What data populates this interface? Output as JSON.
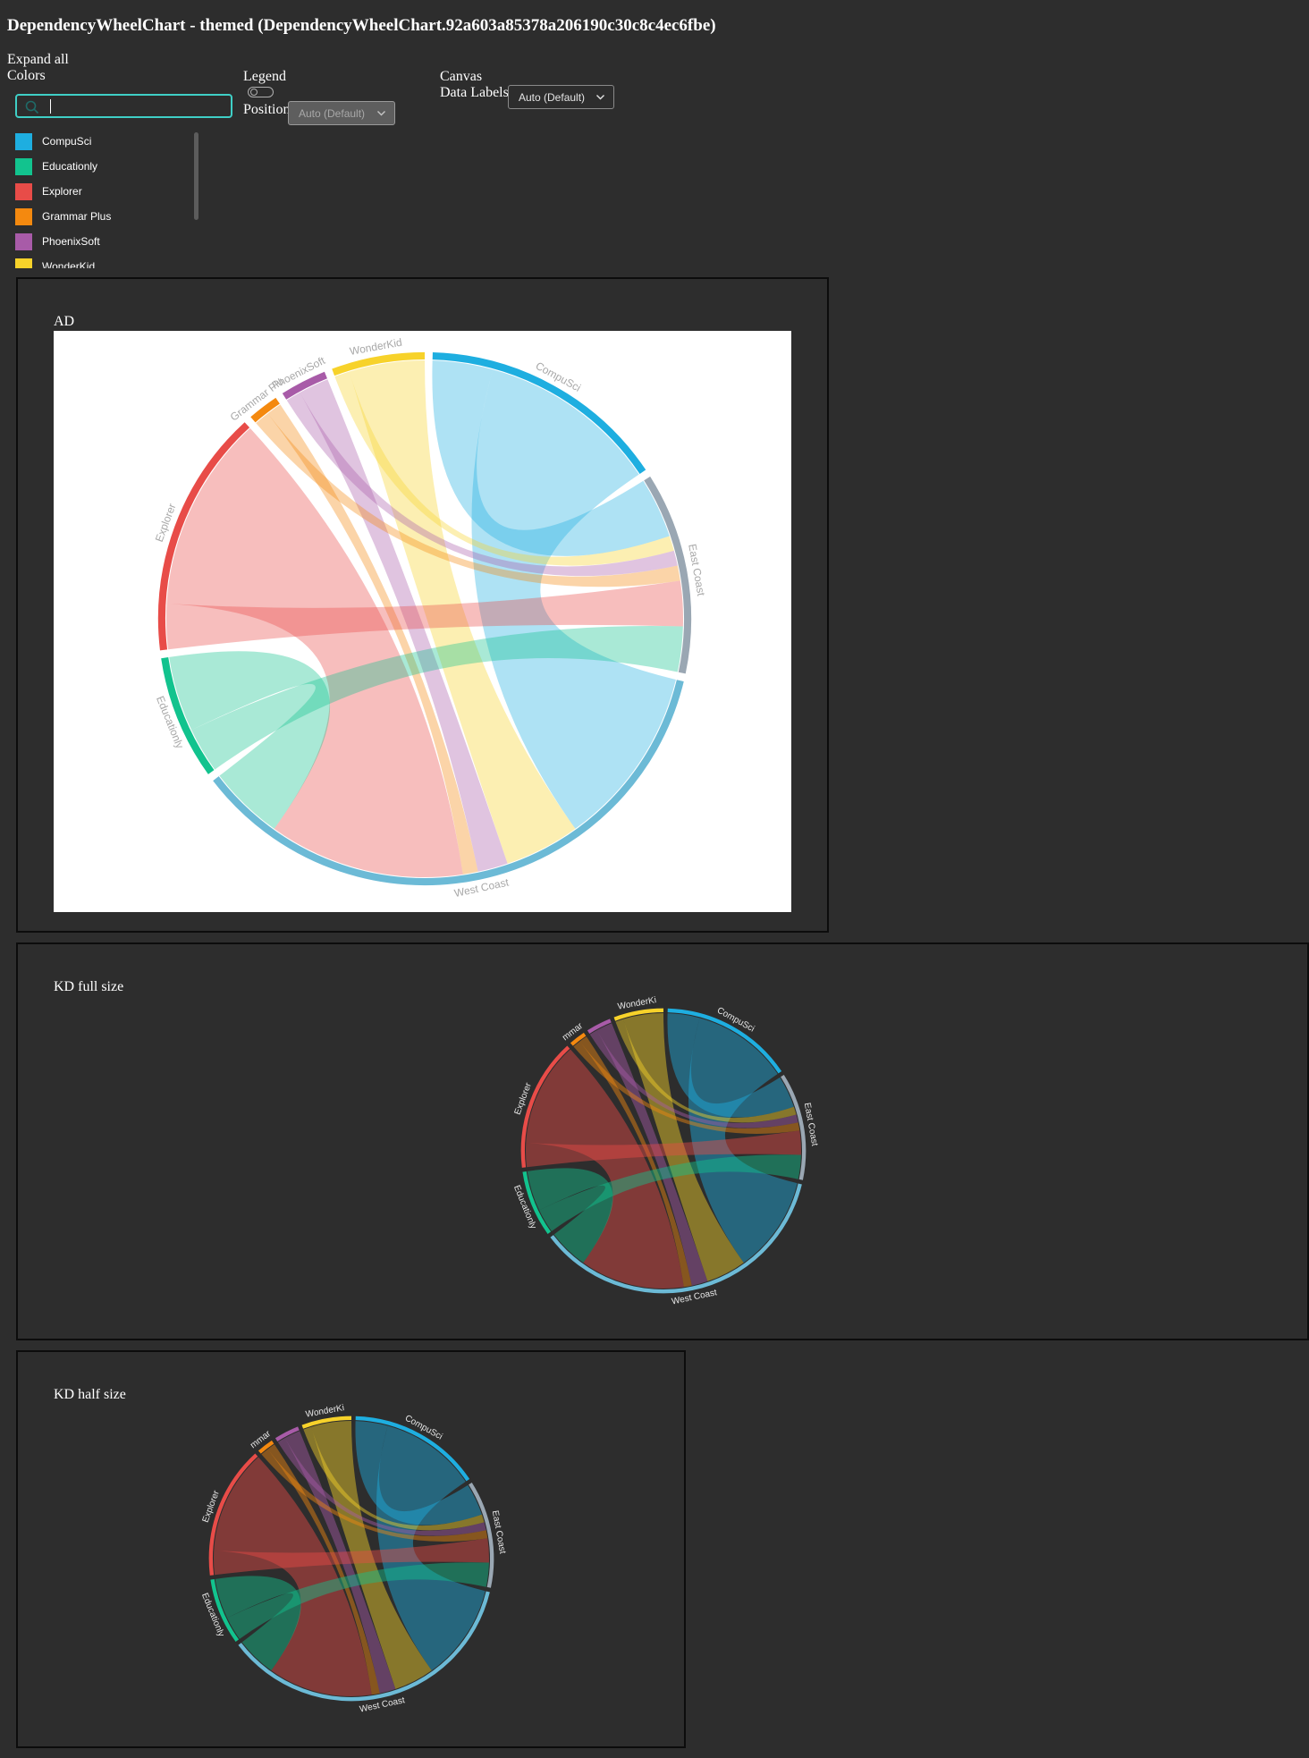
{
  "page": {
    "title": "DependencyWheelChart - themed (DependencyWheelChart.92a603a85378a206190c30c8c4ec6fbe)"
  },
  "controls": {
    "expand_all": "Expand all",
    "colors_label": "Colors",
    "search": {
      "value": "",
      "placeholder": ""
    },
    "colors": [
      {
        "name": "CompuSci",
        "color": "#1eaee0"
      },
      {
        "name": "Educationly",
        "color": "#12c38e"
      },
      {
        "name": "Explorer",
        "color": "#e84c48"
      },
      {
        "name": "Grammar Plus",
        "color": "#f4890f"
      },
      {
        "name": "PhoenixSoft",
        "color": "#a85ba8"
      },
      {
        "name": "WonderKid",
        "color": "#f7d22a"
      }
    ],
    "legend_label": "Legend",
    "legend_toggle_on": false,
    "position_label": "Position",
    "position_value": "Auto (Default)",
    "canvas_label": "Canvas",
    "data_labels_label": "Data Labels",
    "data_labels_value": "Auto (Default)"
  },
  "panels": {
    "ad": {
      "title": "AD"
    },
    "kd_full": {
      "title": "KD full size"
    },
    "kd_half": {
      "title": "KD half size"
    }
  },
  "chart_data": {
    "type": "dependency-wheel",
    "nodes": [
      {
        "name": "CompuSci",
        "color": "#1eaee0"
      },
      {
        "name": "East Coast",
        "color": "#9aa7b3"
      },
      {
        "name": "West Coast",
        "color": "#6cbad6"
      },
      {
        "name": "Educationly",
        "color": "#12c38e"
      },
      {
        "name": "Explorer",
        "color": "#e84c48"
      },
      {
        "name": "Grammar Plus",
        "color": "#f4890f"
      },
      {
        "name": "PhoenixSoft",
        "color": "#a85ba8"
      },
      {
        "name": "WonderKid",
        "color": "#f7d22a"
      }
    ],
    "links": [
      {
        "from": "CompuSci",
        "to": "East Coast",
        "weight": 4
      },
      {
        "from": "CompuSci",
        "to": "West Coast",
        "weight": 12
      },
      {
        "from": "WonderKid",
        "to": "East Coast",
        "weight": 1
      },
      {
        "from": "WonderKid",
        "to": "West Coast",
        "weight": 5
      },
      {
        "from": "PhoenixSoft",
        "to": "East Coast",
        "weight": 1
      },
      {
        "from": "PhoenixSoft",
        "to": "West Coast",
        "weight": 2
      },
      {
        "from": "Grammar Plus",
        "to": "East Coast",
        "weight": 1
      },
      {
        "from": "Grammar Plus",
        "to": "West Coast",
        "weight": 1
      },
      {
        "from": "Explorer",
        "to": "East Coast",
        "weight": 3
      },
      {
        "from": "Explorer",
        "to": "West Coast",
        "weight": 13
      },
      {
        "from": "Educationly",
        "to": "East Coast",
        "weight": 3
      },
      {
        "from": "Educationly",
        "to": "West Coast",
        "weight": 5
      }
    ],
    "node_labels": {
      "ad": {
        "CompuSci": "CompuSci",
        "East Coast": "East Coast",
        "West Coast": "West Coast",
        "Educationly": "Educationly",
        "Explorer": "Explorer",
        "Grammar Plus": "Grammar Plu",
        "PhoenixSoft": "PhoenixSoft",
        "WonderKid": "WonderKid"
      },
      "kd": {
        "CompuSci": "CompuSci",
        "East Coast": "East Coast",
        "West Coast": "West Coast",
        "Educationly": "Educationly",
        "Explorer": "Explorer",
        "Grammar Plus": "mmar",
        "PhoenixSoft": "",
        "WonderKid": "WonderKi"
      }
    },
    "themes": {
      "ad": {
        "background": "#ffffff",
        "label_color": "#a8a8a8",
        "link_opacity": 0.36
      },
      "kd": {
        "background": "#2d2d2d",
        "label_color": "#e6e6e6",
        "link_opacity": 0.45
      }
    }
  }
}
